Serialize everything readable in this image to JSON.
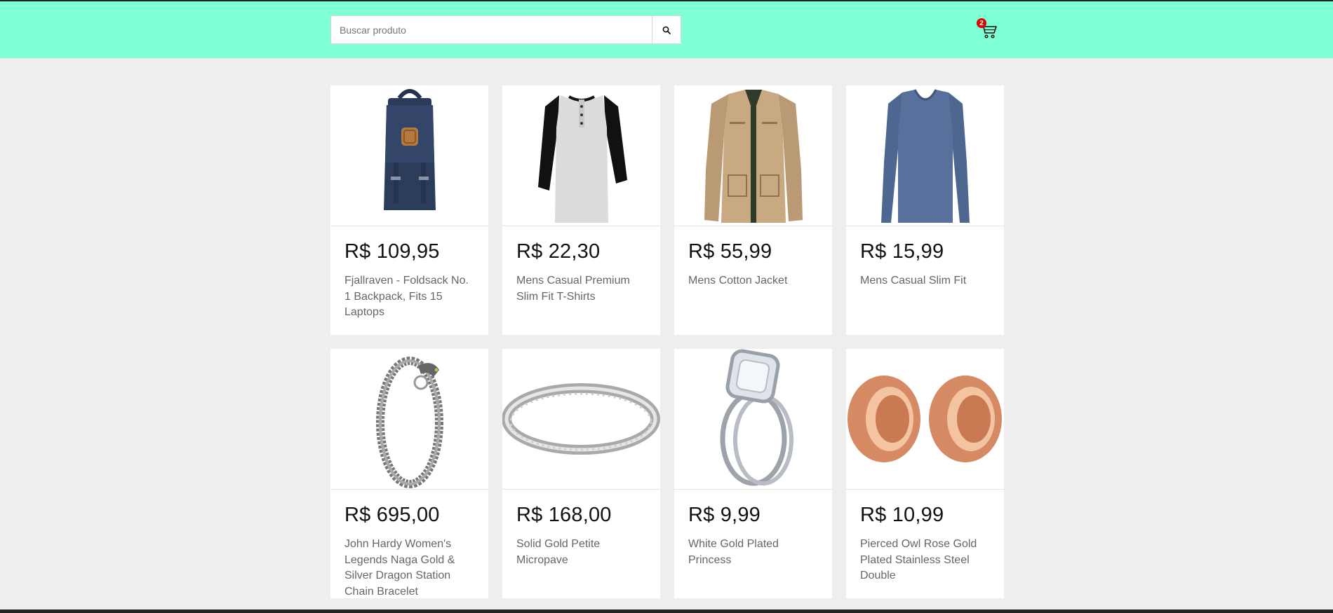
{
  "search": {
    "placeholder": "Buscar produto",
    "icon": "search-icon"
  },
  "cart": {
    "count": "2",
    "icon": "cart-icon",
    "badge_color": "#e00000"
  },
  "colors": {
    "header": "#7fffd4",
    "background": "#eeeeee"
  },
  "products": [
    {
      "price": "R$ 109,95",
      "title": "Fjallraven - Foldsack No. 1 Backpack, Fits 15 Laptops",
      "image": "backpack"
    },
    {
      "price": "R$ 22,30",
      "title": "Mens Casual Premium Slim Fit T-Shirts",
      "image": "raglan-tshirt"
    },
    {
      "price": "R$ 55,99",
      "title": "Mens Cotton Jacket",
      "image": "jacket"
    },
    {
      "price": "R$ 15,99",
      "title": "Mens Casual Slim Fit",
      "image": "long-sleeve-shirt"
    },
    {
      "price": "R$ 695,00",
      "title": "John Hardy Women's Legends Naga Gold & Silver Dragon Station Chain Bracelet",
      "image": "bracelet"
    },
    {
      "price": "R$ 168,00",
      "title": "Solid Gold Petite Micropave",
      "image": "ring"
    },
    {
      "price": "R$ 9,99",
      "title": "White Gold Plated Princess",
      "image": "engagement-rings"
    },
    {
      "price": "R$ 10,99",
      "title": "Pierced Owl Rose Gold Plated Stainless Steel Double",
      "image": "ear-plugs"
    }
  ]
}
